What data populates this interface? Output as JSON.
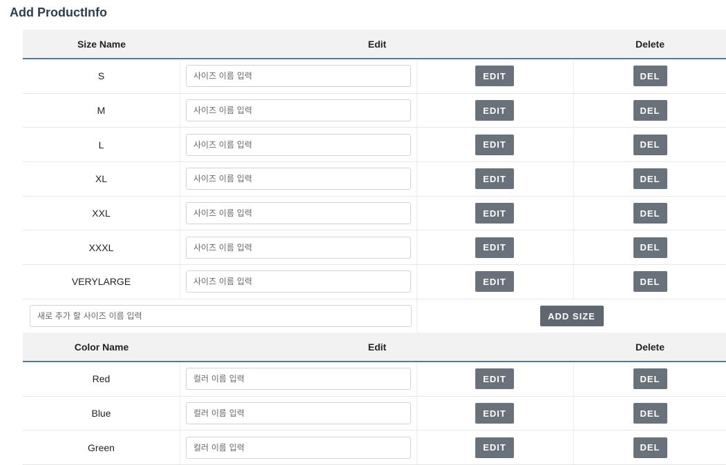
{
  "page": {
    "title": "Add ProductInfo"
  },
  "size_table": {
    "headers": {
      "name": "Size Name",
      "edit": "Edit",
      "delete": "Delete"
    },
    "rows": [
      {
        "name": "S",
        "placeholder": "사이즈 이름 입력",
        "edit_label": "EDIT",
        "delete_label": "DEL"
      },
      {
        "name": "M",
        "placeholder": "사이즈 이름 입력",
        "edit_label": "EDIT",
        "delete_label": "DEL"
      },
      {
        "name": "L",
        "placeholder": "사이즈 이름 입력",
        "edit_label": "EDIT",
        "delete_label": "DEL"
      },
      {
        "name": "XL",
        "placeholder": "사이즈 이름 입력",
        "edit_label": "EDIT",
        "delete_label": "DEL"
      },
      {
        "name": "XXL",
        "placeholder": "사이즈 이름 입력",
        "edit_label": "EDIT",
        "delete_label": "DEL"
      },
      {
        "name": "XXXL",
        "placeholder": "사이즈 이름 입력",
        "edit_label": "EDIT",
        "delete_label": "DEL"
      },
      {
        "name": "VERYLARGE",
        "placeholder": "사이즈 이름 입력",
        "edit_label": "EDIT",
        "delete_label": "DEL"
      }
    ],
    "add": {
      "placeholder": "새로 추가 할 사이즈 이름 입력",
      "button_label": "ADD SIZE"
    }
  },
  "color_table": {
    "headers": {
      "name": "Color Name",
      "edit": "Edit",
      "delete": "Delete"
    },
    "rows": [
      {
        "name": "Red",
        "placeholder": "컬러 이름 입력",
        "edit_label": "EDIT",
        "delete_label": "DEL"
      },
      {
        "name": "Blue",
        "placeholder": "컬러 이름 입력",
        "edit_label": "EDIT",
        "delete_label": "DEL"
      },
      {
        "name": "Green",
        "placeholder": "컬러 이름 입력",
        "edit_label": "EDIT",
        "delete_label": "DEL"
      }
    ]
  },
  "colors": {
    "title": "#2c3e50",
    "header_bg": "#f2f2f2",
    "header_border": "#4d7a9e",
    "button_bg": "#69727b",
    "button_text": "#ffffff"
  }
}
